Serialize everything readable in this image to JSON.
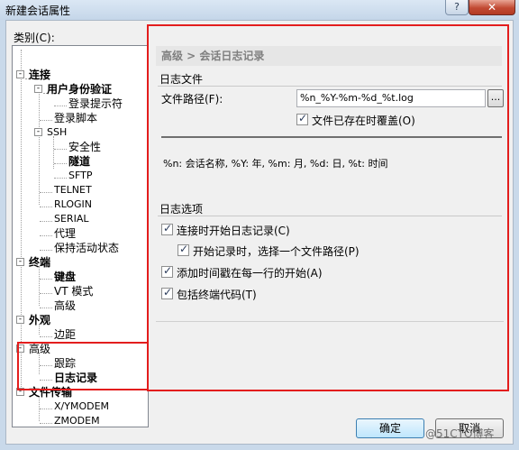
{
  "window": {
    "title": "新建会话属性",
    "help_label": "?",
    "close_label": "✕"
  },
  "category_label": "类别(C):",
  "tree": {
    "connection": "连接",
    "auth": "用户身份验证",
    "login_prompt": "登录提示符",
    "login_script": "登录脚本",
    "ssh": "SSH",
    "security": "安全性",
    "tunnel": "隧道",
    "sftp": "SFTP",
    "telnet": "TELNET",
    "rlogin": "RLOGIN",
    "serial": "SERIAL",
    "proxy": "代理",
    "keepalive": "保持活动状态",
    "terminal": "终端",
    "keyboard": "键盘",
    "vt_mode": "VT 模式",
    "term_advanced": "高级",
    "appearance": "外观",
    "margin": "边距",
    "advanced": "高级",
    "trace": "跟踪",
    "logging": "日志记录",
    "file_transfer": "文件传输",
    "xymodem": "X/YMODEM",
    "zmodem": "ZMODEM",
    "expander_collapsed": "-"
  },
  "panel": {
    "breadcrumb": "高级 > 会话日志记录",
    "log_file_group": "日志文件",
    "file_path_label": "文件路径(F):",
    "file_path_value": "%n_%Y-%m-%d_%t.log",
    "browse_label": "...",
    "overwrite_label": "文件已存在时覆盖(O)",
    "help_text": "%n: 会话名称, %Y: 年, %m: 月, %d: 日, %t: 时间",
    "log_options_group": "日志选项",
    "opt_start_on_connect": "连接时开始日志记录(C)",
    "opt_choose_path": "开始记录时，选择一个文件路径(P)",
    "opt_timestamp": "添加时间戳在每一行的开始(A)",
    "opt_terminal_codes": "包括终端代码(T)"
  },
  "buttons": {
    "ok": "确定",
    "cancel": "取消"
  },
  "watermark": "@51CTO博客",
  "colors": {
    "highlight_outline": "#e31d1d"
  }
}
